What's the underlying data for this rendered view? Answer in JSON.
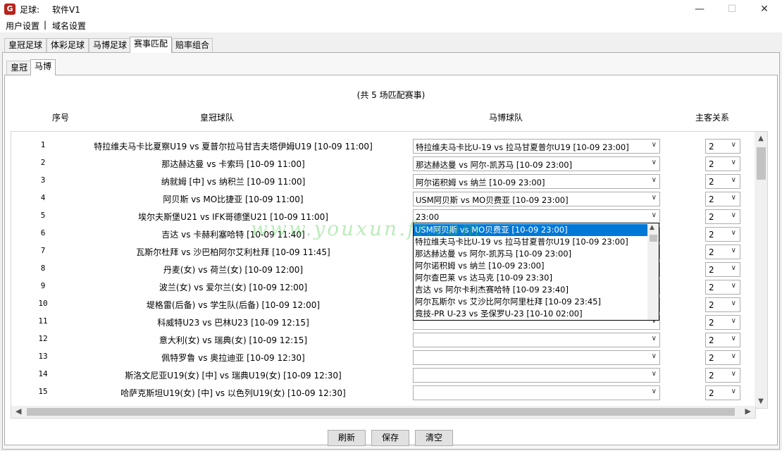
{
  "window": {
    "title": "足球:",
    "version": "软件V1",
    "icon_label": "G",
    "minimize": "—",
    "maximize": "☐",
    "close": "✕"
  },
  "menu": {
    "items": [
      "用户设置",
      "域名设置"
    ],
    "separator": "|"
  },
  "tabs": [
    "皇冠足球",
    "体彩足球",
    "马博足球",
    "赛事匹配",
    "赔率组合"
  ],
  "subtabs": [
    "皇冠",
    "马博"
  ],
  "summary": "(共 5 场匹配赛事)",
  "headers": {
    "index": "序号",
    "crown": "皇冠球队",
    "mabo": "马博球队",
    "relation": "主客关系"
  },
  "rows": [
    {
      "idx": "1",
      "crown": "特拉维夫马卡比夏察U19 vs 夏普尔拉马甘吉夫塔伊姆U19 [10-09 11:00]",
      "mabo": "特拉维夫马卡比U-19 vs 拉马甘夏普尔U19 [10-09 23:00]",
      "rel": "2"
    },
    {
      "idx": "2",
      "crown": "那达赫达曼 vs 卡索玛 [10-09 11:00]",
      "mabo": "那达赫达曼 vs 阿尔-凯苏马 [10-09 23:00]",
      "rel": "2"
    },
    {
      "idx": "3",
      "crown": "纳就姆 [中] vs 纳积兰 [10-09 11:00]",
      "mabo": "阿尔诺积姆 vs 纳兰 [10-09 23:00]",
      "rel": "2"
    },
    {
      "idx": "4",
      "crown": "阿贝斯 vs MO比捷亚 [10-09 11:00]",
      "mabo": "USM阿贝斯 vs MO贝费亚 [10-09 23:00]",
      "rel": "2"
    },
    {
      "idx": "5",
      "crown": "埃尔夫斯堡U21 vs IFK哥德堡U21 [10-09 11:00]",
      "mabo": "23:00",
      "rel": "2"
    },
    {
      "idx": "6",
      "crown": "吉达 vs 卡赫利塞哈特 [10-09 11:40]",
      "mabo": "",
      "rel": "2"
    },
    {
      "idx": "7",
      "crown": "瓦斯尔杜拜 vs 沙巴柏阿尔艾利杜拜 [10-09 11:45]",
      "mabo": "",
      "rel": "2"
    },
    {
      "idx": "8",
      "crown": "丹麦(女) vs 荷兰(女) [10-09 12:00]",
      "mabo": "",
      "rel": "2"
    },
    {
      "idx": "9",
      "crown": "波兰(女) vs 爱尔兰(女) [10-09 12:00]",
      "mabo": "",
      "rel": "2"
    },
    {
      "idx": "10",
      "crown": "堤格雷(后备) vs 学生队(后备) [10-09 12:00]",
      "mabo": "",
      "rel": "2"
    },
    {
      "idx": "11",
      "crown": "科威特U23 vs 巴林U23 [10-09 12:15]",
      "mabo": "",
      "rel": "2"
    },
    {
      "idx": "12",
      "crown": "意大利(女) vs 瑞典(女) [10-09 12:15]",
      "mabo": "",
      "rel": "2"
    },
    {
      "idx": "13",
      "crown": "佩特罗鲁 vs 奥拉迪亚 [10-09 12:30]",
      "mabo": "",
      "rel": "2"
    },
    {
      "idx": "14",
      "crown": "斯洛文尼亚U19(女) [中] vs 瑞典U19(女) [10-09 12:30]",
      "mabo": "",
      "rel": "2"
    },
    {
      "idx": "15",
      "crown": "哈萨克斯坦U19(女) [中] vs 以色列U19(女) [10-09 12:30]",
      "mabo": "",
      "rel": "2"
    }
  ],
  "dropdown": {
    "items": [
      "USM阿贝斯 vs MO贝费亚 [10-09 23:00]",
      "特拉维夫马卡比U-19 vs 拉马甘夏普尔U19 [10-09 23:00]",
      "那达赫达曼 vs 阿尔-凯苏马 [10-09 23:00]",
      "阿尔诺积姆 vs 纳兰 [10-09 23:00]",
      "阿尔查巴莱 vs 达马克 [10-09 23:30]",
      "吉达 vs 阿尔卡利杰赛哈特 [10-09 23:40]",
      "阿尔瓦斯尔 vs 艾沙比阿尔阿里杜拜 [10-09 23:45]",
      "竟技-PR U-23 vs 圣保罗U-23 [10-10 02:00]"
    ]
  },
  "watermark": "www.youxun.fr.com",
  "buttons": {
    "refresh": "刷新",
    "save": "保存",
    "clear": "清空"
  },
  "colors": {
    "selection": "#0078d7",
    "watermark": "#3cc83c"
  }
}
